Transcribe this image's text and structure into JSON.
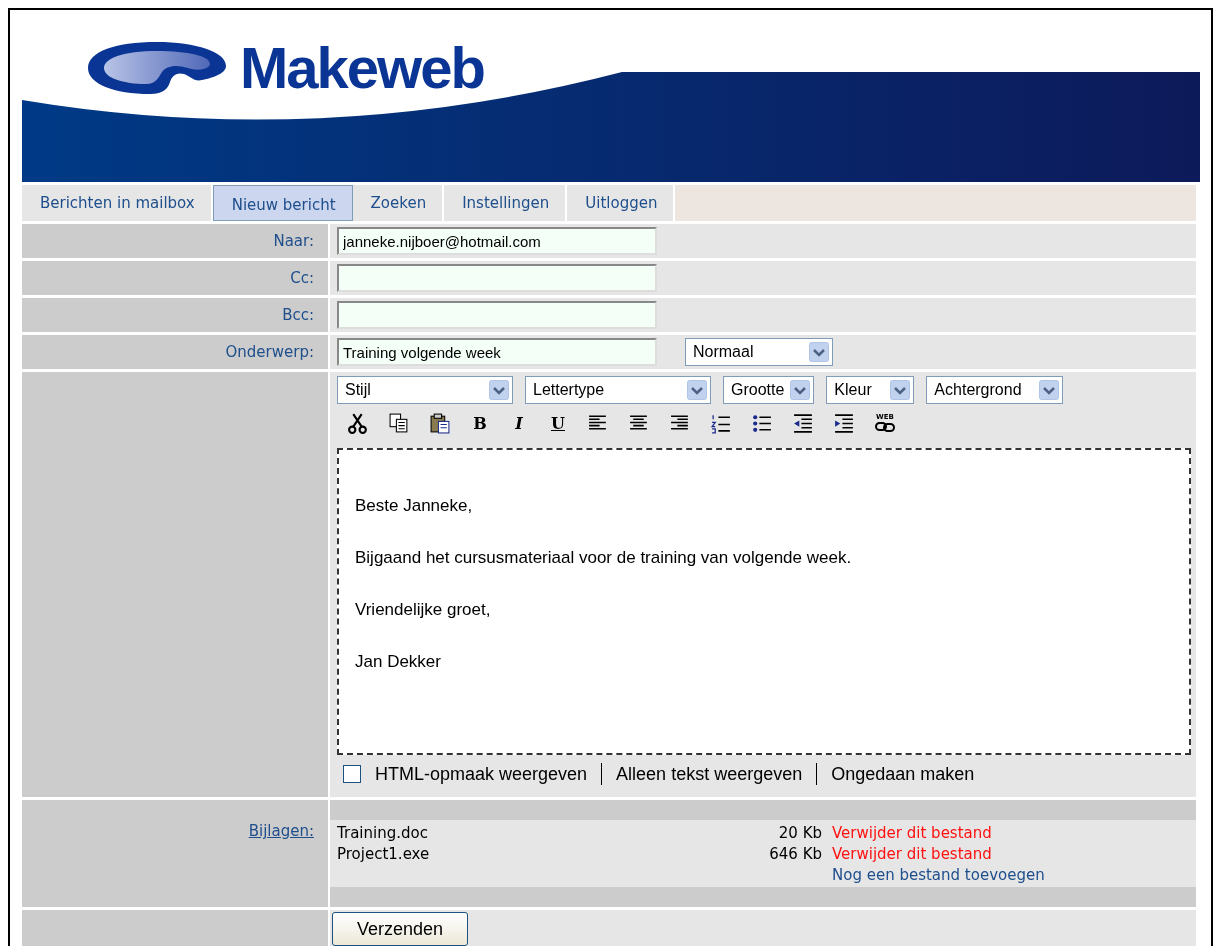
{
  "logo": {
    "name": "Makeweb"
  },
  "tabs": [
    {
      "label": "Berichten in mailbox",
      "selected": false
    },
    {
      "label": "Nieuw bericht",
      "selected": true
    },
    {
      "label": "Zoeken",
      "selected": false
    },
    {
      "label": "Instellingen",
      "selected": false
    },
    {
      "label": "Uitloggen",
      "selected": false
    }
  ],
  "fields": [
    {
      "label": "Naar:",
      "value": "janneke.nijboer@hotmail.com"
    },
    {
      "label": "Cc:"
    },
    {
      "label": "Bcc:"
    },
    {
      "label": "Onderwerp:",
      "value": "Training volgende week",
      "priority": "Normaal"
    }
  ],
  "editor": {
    "selects": [
      {
        "value": "Stijl"
      },
      {
        "value": "Lettertype"
      },
      {
        "value": "Grootte"
      },
      {
        "value": "Kleur"
      },
      {
        "value": "Achtergrond"
      }
    ],
    "tools": [
      {
        "kind": "cut"
      },
      {
        "kind": "copy"
      },
      {
        "kind": "paste"
      },
      {
        "kind": "bold",
        "label": "B"
      },
      {
        "kind": "italic",
        "label": "I"
      },
      {
        "kind": "underline",
        "label": "U"
      },
      {
        "kind": "align-left"
      },
      {
        "kind": "align-center"
      },
      {
        "kind": "align-right"
      },
      {
        "kind": "ordered-list"
      },
      {
        "kind": "bullet-list"
      },
      {
        "kind": "outdent"
      },
      {
        "kind": "indent"
      },
      {
        "kind": "web-link",
        "label": "WEB"
      }
    ],
    "body": [
      "Beste Janneke,",
      "Bijgaand het cursusmateriaal voor de training van volgende week.",
      "Vriendelijke groet,",
      "Jan Dekker"
    ],
    "html_mode": {
      "label": "HTML-opmaak weergeven",
      "checked": false
    },
    "actions": [
      "Alleen tekst weergeven",
      "Ongedaan maken"
    ]
  },
  "attachments": {
    "label": "Bijlagen:",
    "files": [
      {
        "name": "Training.doc",
        "size": "20 Kb",
        "remove": "Verwijder dit bestand"
      },
      {
        "name": "Project1.exe",
        "size": "646 Kb",
        "remove": "Verwijder dit bestand"
      }
    ],
    "add": "Nog een bestand toevoegen"
  },
  "send_button": "Verzenden"
}
